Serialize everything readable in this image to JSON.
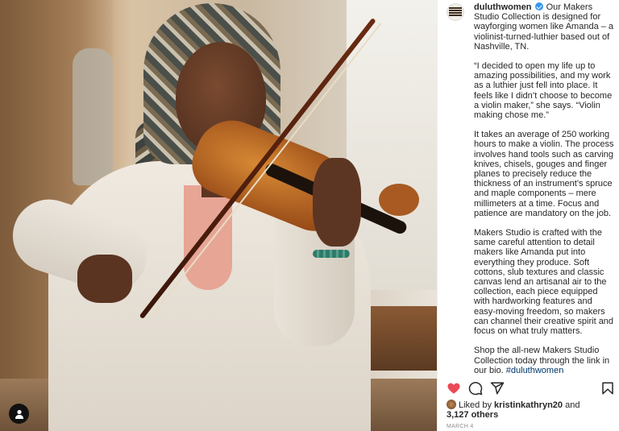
{
  "post": {
    "username": "duluthwomen",
    "caption_intro": "Our Makers Studio Collection is designed for wayforging women like Amanda – a violinist-turned-luthier based out of Nashville, TN.",
    "paragraph_2": "“I decided to open my life up to amazing possibilities, and my work as a luthier just fell into place. It feels like I didn’t choose to become a violin maker,” she says. “Violin making chose me.”",
    "paragraph_3": "It takes an average of 250 working hours to make a violin. The process involves hand tools such as carving knives, chisels, gouges and finger planes to precisely reduce the thickness of an instrument’s spruce and maple components – mere millimeters at a time. Focus and patience are mandatory on the job.",
    "paragraph_4": "Makers Studio is crafted with the same careful attention to detail makers like Amanda put into everything they produce. Soft cottons, slub textures and classic canvas lend an artisanal air to the collection, each piece equipped with hardworking features and easy-moving freedom, so makers can channel their creative spirit and focus on what truly matters.",
    "paragraph_5": "Shop the all-new Makers Studio Collection today through the link in our bio.",
    "hashtag": "#duluthwomen"
  },
  "likes": {
    "prefix": "Liked by",
    "liker": "kristinkathryn20",
    "and": "and",
    "others": "3,127 others"
  },
  "date": "MARCH 4",
  "colors": {
    "like_red": "#ed4956",
    "verified_blue": "#3897f0",
    "hashtag_blue": "#00376b",
    "muted_gray": "#8e8e8e"
  },
  "icons": {
    "like": "heart-icon-filled",
    "comment": "comment-bubble-icon",
    "share": "paper-plane-icon",
    "save": "bookmark-icon",
    "tag": "user-icon"
  }
}
